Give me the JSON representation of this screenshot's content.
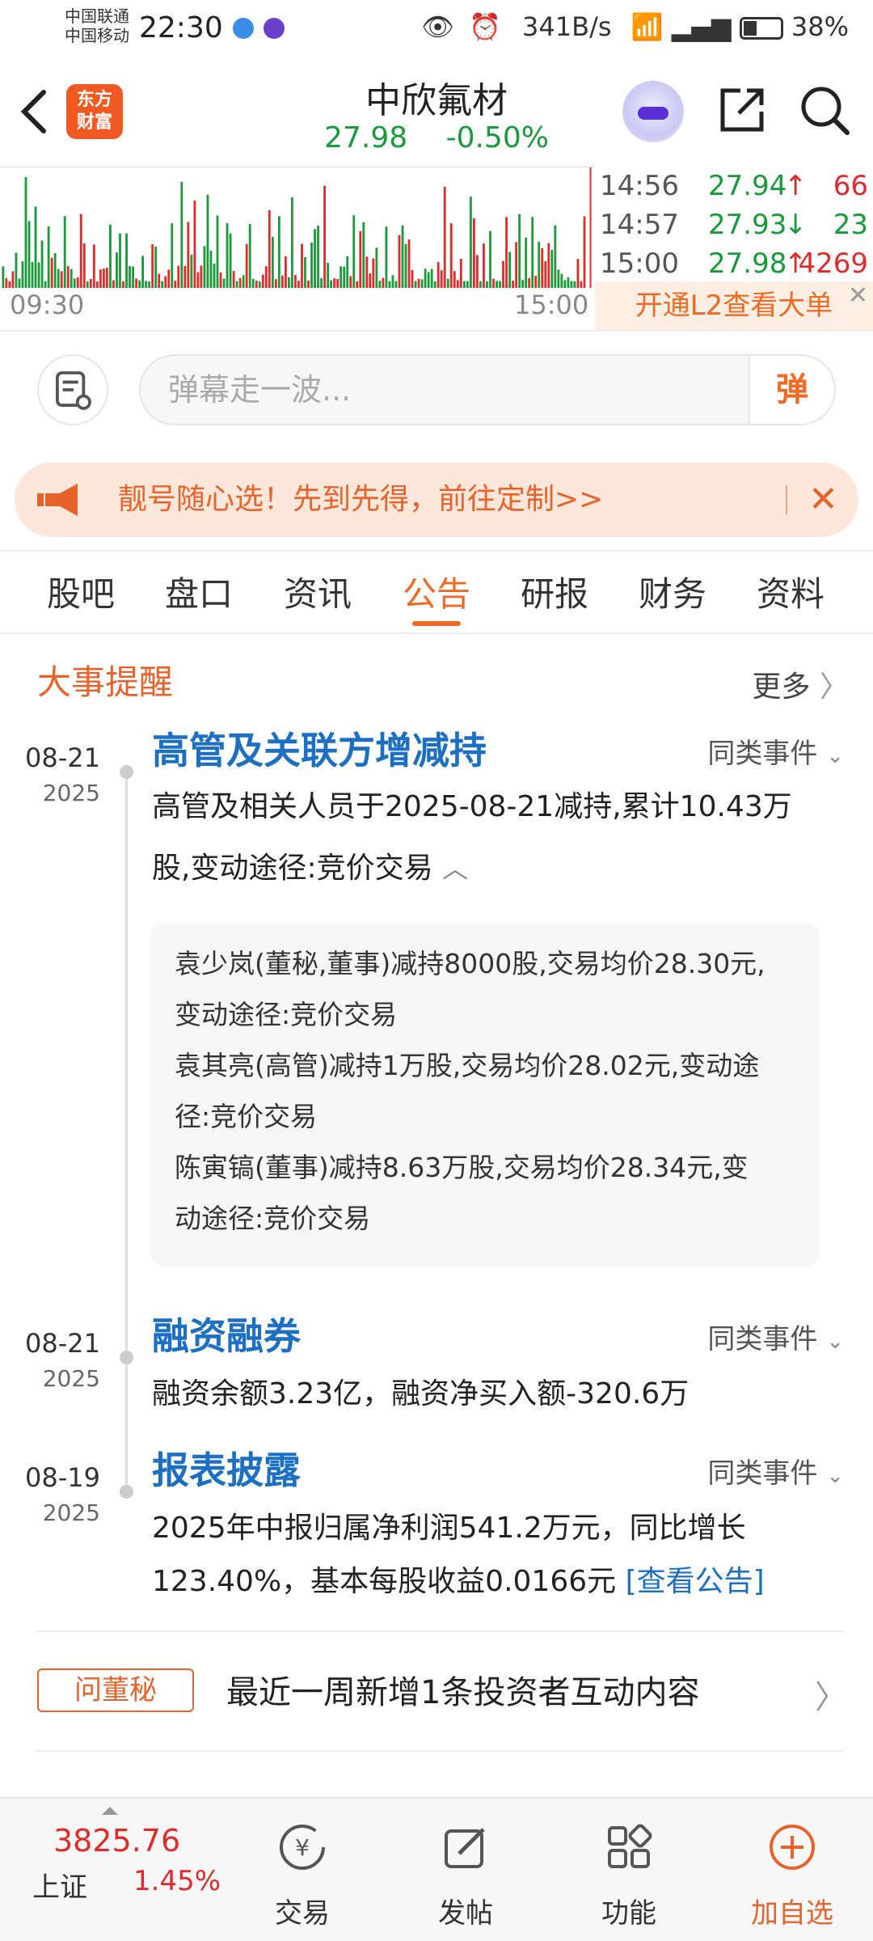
{
  "status_bar": {
    "carrier1": "中国联通",
    "carrier2": "中国移动",
    "time": "22:30",
    "speed": "341B/s",
    "battery": "38%"
  },
  "header": {
    "logo_line1": "东方",
    "logo_line2": "财富",
    "stock_name": "中欣氟材",
    "price": "27.98",
    "change": "-0.50%"
  },
  "mini_chart": {
    "time_start": "09:30",
    "time_end": "15:00",
    "ticks": [
      {
        "time": "14:56",
        "price": "27.94",
        "dir": "↑",
        "vol": "66"
      },
      {
        "time": "14:57",
        "price": "27.93",
        "dir": "↓",
        "vol": "23"
      },
      {
        "time": "15:00",
        "price": "27.98",
        "dir": "↑",
        "vol": "4269"
      }
    ],
    "l2_label": "开通L2查看大单"
  },
  "danmaku": {
    "placeholder": "弹幕走一波...",
    "button": "弹"
  },
  "banner": {
    "text": "靓号随心选！先到先得，前往定制>>"
  },
  "tabs": [
    "股吧",
    "盘口",
    "资讯",
    "公告",
    "研报",
    "财务",
    "资料"
  ],
  "active_tab": "公告",
  "events_section": {
    "title": "大事提醒",
    "more": "更多",
    "same_label": "同类事件",
    "events": [
      {
        "date": "08-21",
        "year": "2025",
        "title": "高管及关联方增减持",
        "text_line1": "高管及相关人员于2025-08-21减持,累计10.43万",
        "text_line2": "股,变动途径:竞价交易",
        "details": [
          "袁少岚(董秘,董事)减持8000股,交易均价28.30元,",
          "变动途径:竞价交易",
          "袁其亮(高管)减持1万股,交易均价28.02元,变动途",
          "径:竞价交易",
          "陈寅镐(董事)减持8.63万股,交易均价28.34元,变",
          "动途径:竞价交易"
        ]
      },
      {
        "date": "08-21",
        "year": "2025",
        "title": "融资融券",
        "text_line1": "融资余额3.23亿，融资净买入额-320.6万"
      },
      {
        "date": "08-19",
        "year": "2025",
        "title": "报表披露",
        "text_line1": "2025年中报归属净利润541.2万元，同比增长",
        "text_line2": "123.40%，基本每股收益0.0166元",
        "link": "[查看公告]"
      }
    ]
  },
  "dongmi": {
    "badge": "问董秘",
    "text": "最近一周新增1条投资者互动内容"
  },
  "bottom_bar": {
    "index_value": "3825.76",
    "index_name": "上证",
    "index_pct": "1.45%",
    "buttons": [
      "交易",
      "发帖",
      "功能",
      "加自选"
    ]
  },
  "colors": {
    "accent": "#f06a23",
    "up": "#e02b2b",
    "down": "#1a9a3a",
    "link": "#1d6fc2"
  }
}
